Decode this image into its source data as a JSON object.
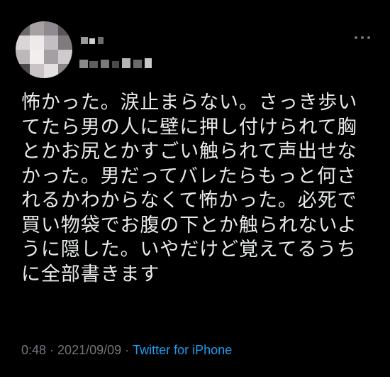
{
  "tweet": {
    "more_icon": "more-horizontal-icon",
    "text_lines": [
      "怖かった。涙止まらない。さっき歩い",
      "てたら男の人に壁に押し付けられて胸",
      "とかお尻とかすごい触られて声出せな",
      "かった。男だってバレたらもっと何さ",
      "れるかわからなくて怖かった。必死で",
      "買い物袋でお腹の下とか触られないよ",
      "うに隠した。いやだけど覚えてるうち",
      "に全部書きます"
    ],
    "time": "0:48",
    "separator": "·",
    "date": "2021/09/09",
    "source": "Twitter for iPhone"
  },
  "colors": {
    "background": "#000000",
    "text": "#e7e9ea",
    "muted": "#71767b",
    "link": "#1d9bf0"
  }
}
